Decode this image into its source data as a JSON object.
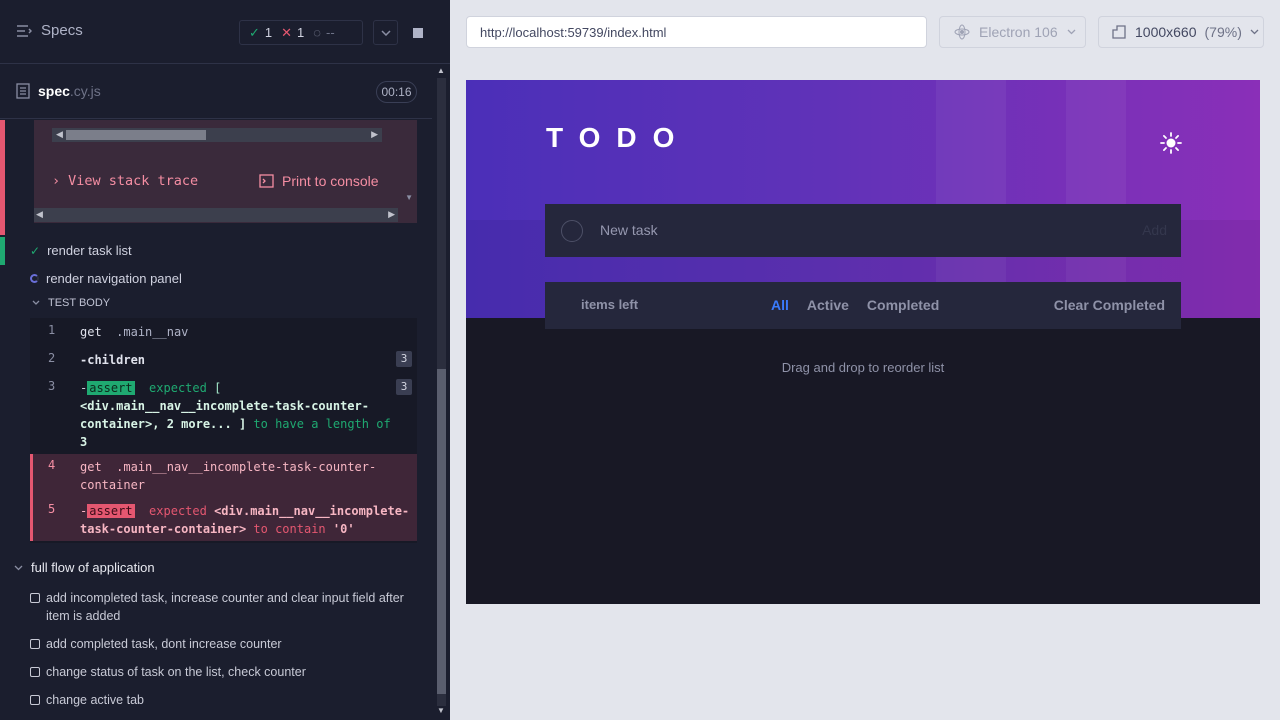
{
  "reporter": {
    "specs_label": "Specs",
    "passed_count": "1",
    "failed_count": "1",
    "pending_count": "--",
    "spec_name": "spec",
    "spec_ext": ".cy.js",
    "duration": "00:16"
  },
  "error": {
    "view_stack_trace": "View stack trace",
    "print_to_console": "Print to console"
  },
  "tests": {
    "render_task_list": "render task list",
    "render_navigation_panel": "render navigation panel",
    "test_body_label": "TEST BODY"
  },
  "commands": [
    {
      "num": "1",
      "name": "get",
      "arg": ".main__nav"
    },
    {
      "num": "2",
      "name": "-children",
      "count": "3"
    },
    {
      "num": "3",
      "name": "-",
      "badge": "assert",
      "text1": "expected",
      "text2": "[",
      "arg": "<div.main__nav__incomplete-task-counter-container>, 2 more... ]",
      "text3": "to have a length of",
      "text4": "3",
      "count": "3"
    },
    {
      "num": "4",
      "name": "get",
      "arg": ".main__nav__incomplete-task-counter-container"
    },
    {
      "num": "5",
      "name": "-",
      "badge": "assert",
      "text1": "expected",
      "arg": "<div.main__nav__incomplete-task-counter-container>",
      "text3": "to contain",
      "text4": "'0'"
    }
  ],
  "suite": {
    "name": "full flow of application",
    "pending_tests": [
      "add incompleted task, increase counter and clear input field after item is added",
      "add completed task, dont increase counter",
      "change status of task on the list, check counter",
      "change active tab"
    ]
  },
  "aut": {
    "url": "http://localhost:59739/index.html",
    "browser": "Electron 106",
    "viewport": "1000x660",
    "zoom": "(79%)"
  },
  "todo": {
    "title": "TODO",
    "placeholder": "New task",
    "add_label": "Add",
    "items_left": "items left",
    "filters": [
      "All",
      "Active",
      "Completed"
    ],
    "clear_completed": "Clear Completed",
    "drag_hint": "Drag and drop to reorder list"
  },
  "colors": {
    "pass": "#1fa971",
    "fail": "#e45770",
    "active_filter": "#3a7bfd"
  }
}
